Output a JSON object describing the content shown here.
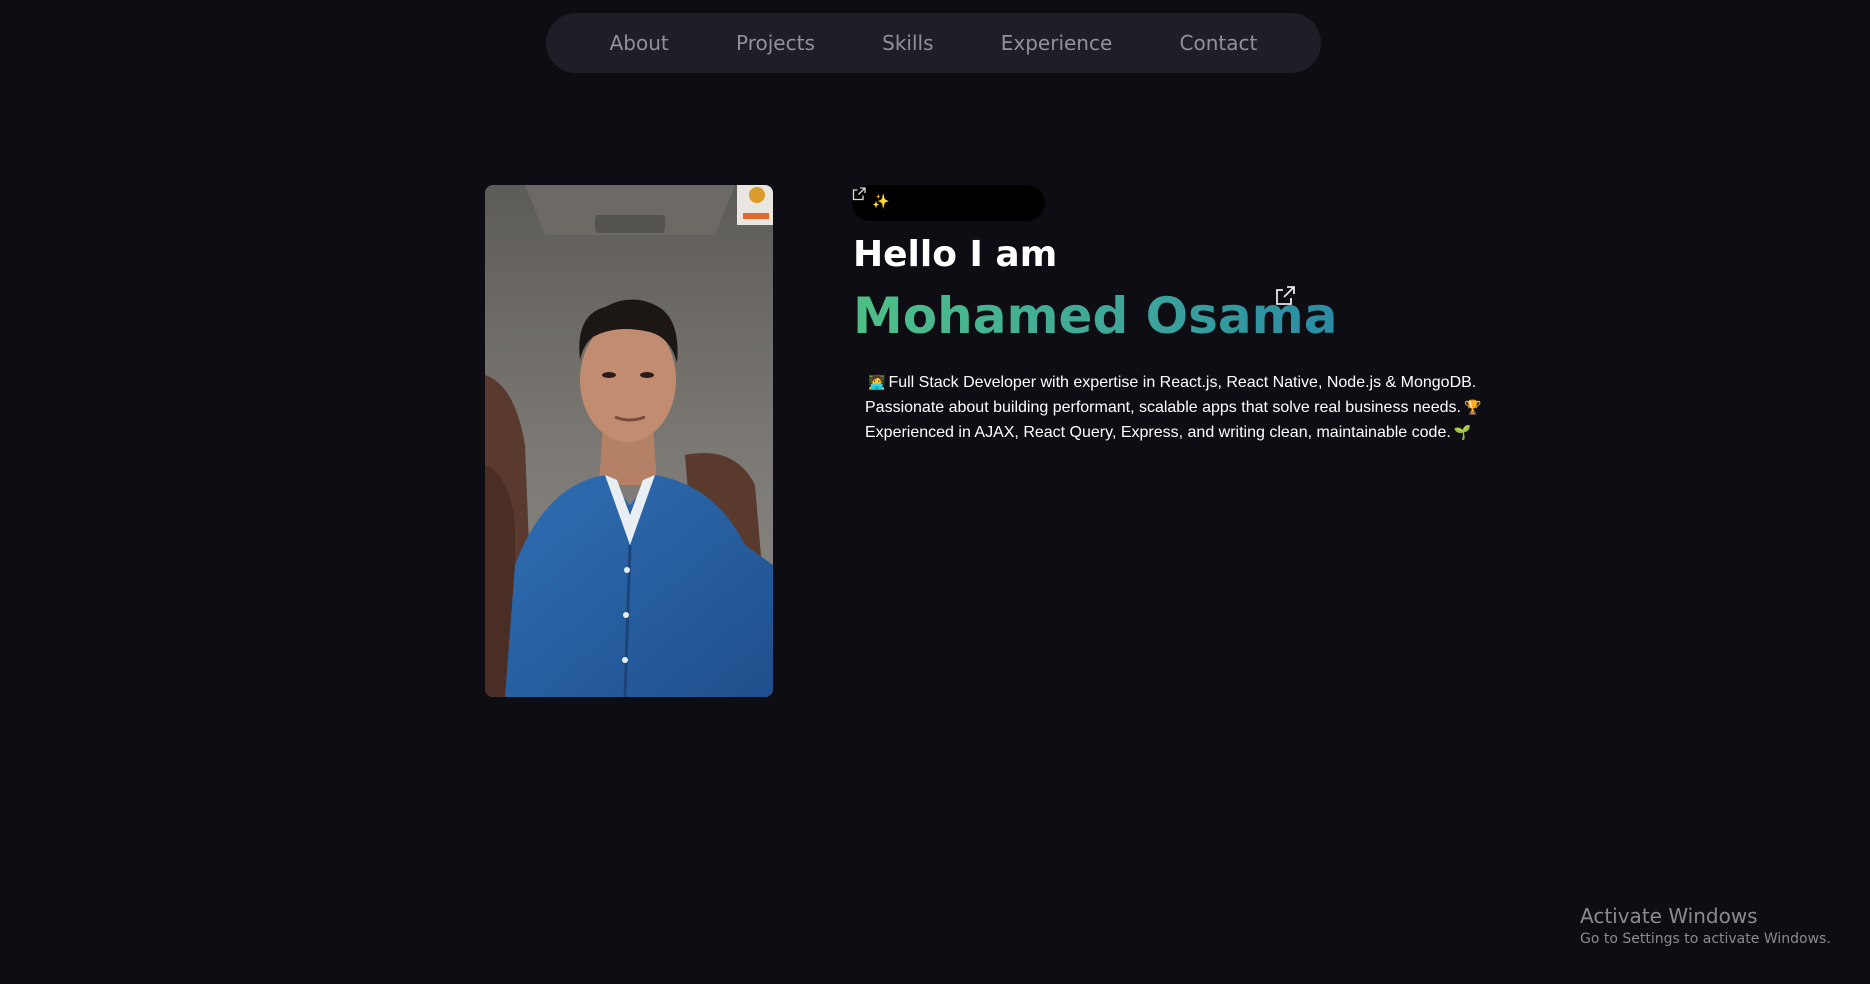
{
  "nav": {
    "items": [
      {
        "label": "About"
      },
      {
        "label": "Projects"
      },
      {
        "label": "Skills"
      },
      {
        "label": "Experience"
      },
      {
        "label": "Contact"
      }
    ]
  },
  "hero": {
    "badge": {
      "icons": [
        "external-link-icon",
        "sparkles-icon"
      ]
    },
    "greeting": "Hello I am",
    "name": "Mohamed Osama",
    "name_gradient": [
      "#4fbf86",
      "#2a8ba4"
    ],
    "description": {
      "line1_emoji": "technologist-emoji",
      "line1": "Full Stack Developer with expertise in React.js, React Native, Node.js & MongoDB.",
      "line2": "Passionate about building performant, scalable apps that solve real business needs.",
      "line2_emoji": "trophy-emoji",
      "line3": "Experienced in AJAX, React Query, Express, and writing clean, maintainable code.",
      "line3_emoji": "seedling-emoji"
    },
    "photo": {
      "subject": "profile-photo"
    }
  },
  "watermark": {
    "title": "Activate Windows",
    "subtitle": "Go to Settings to activate Windows."
  },
  "colors": {
    "background": "#0e0d13",
    "nav_background": "#1e1e27",
    "nav_text": "#8f919d"
  }
}
